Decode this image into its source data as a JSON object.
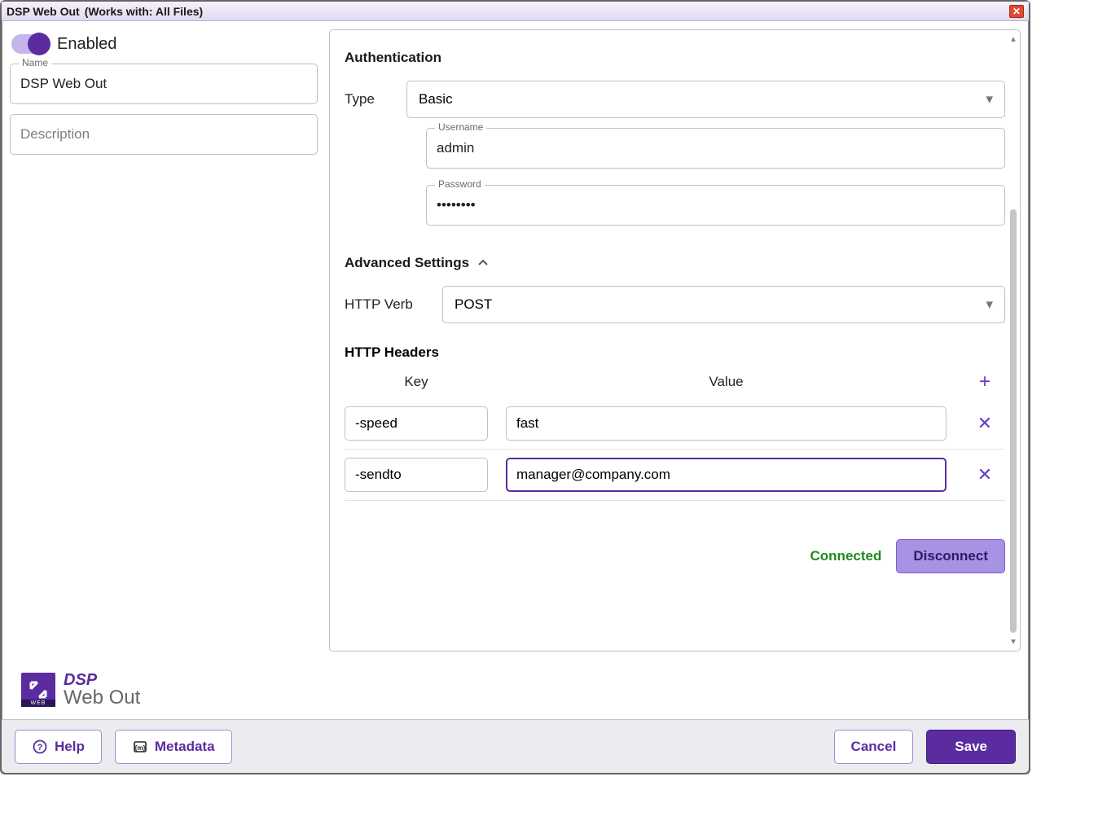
{
  "window": {
    "title": "DSP Web Out",
    "subtitle": "(Works with: All Files)"
  },
  "enabled": {
    "label": "Enabled",
    "on": true
  },
  "left": {
    "name_label": "Name",
    "name_value": "DSP Web Out",
    "description_placeholder": "Description",
    "description_value": ""
  },
  "auth": {
    "section": "Authentication",
    "type_label": "Type",
    "type_value": "Basic",
    "username_label": "Username",
    "username_value": "admin",
    "password_label": "Password",
    "password_value": "••••••••"
  },
  "advanced": {
    "section": "Advanced Settings",
    "expanded": true,
    "http_verb_label": "HTTP Verb",
    "http_verb_value": "POST",
    "http_headers_label": "HTTP Headers",
    "headers": {
      "key_header": "Key",
      "value_header": "Value",
      "rows": [
        {
          "key": "-speed",
          "value": "fast"
        },
        {
          "key": "-sendto",
          "value": "manager@company.com"
        }
      ]
    }
  },
  "connection": {
    "status": "Connected",
    "disconnect_label": "Disconnect"
  },
  "brand": {
    "line1": "DSP",
    "line2": "Web Out",
    "logo_text": "WEB"
  },
  "footer": {
    "help": "Help",
    "metadata": "Metadata",
    "cancel": "Cancel",
    "save": "Save"
  }
}
